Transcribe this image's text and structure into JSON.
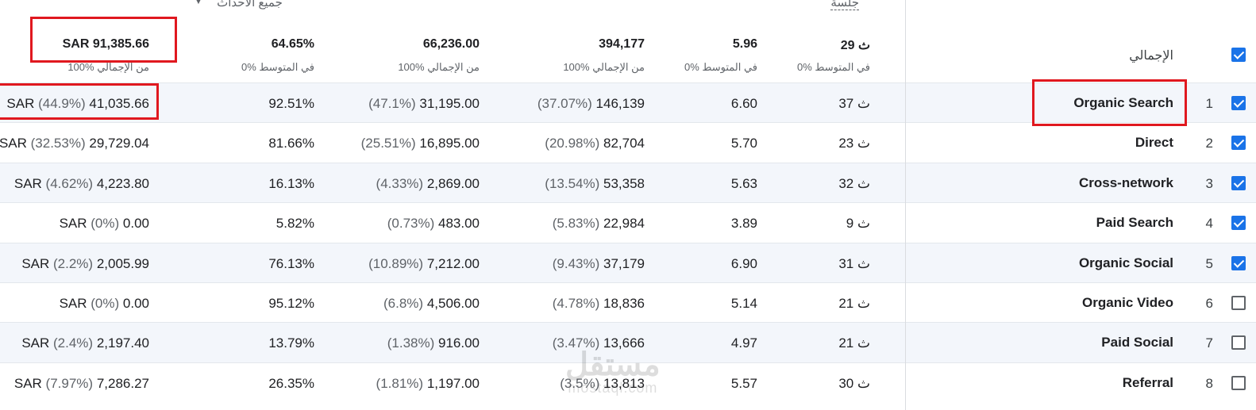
{
  "header": {
    "events_dropdown_label": "جميع الأحداث",
    "session_label": "جلسة",
    "total_label": "الإجمالي",
    "columns": [
      {
        "value": "SAR 91,385.66",
        "sub": "100% من الإجمالي"
      },
      {
        "value": "64.65%",
        "sub": "0% في المتوسط"
      },
      {
        "value": "66,236.00",
        "sub": "100% من الإجمالي"
      },
      {
        "value": "394,177",
        "sub": "100% من الإجمالي"
      },
      {
        "value": "5.96",
        "sub": "0% في المتوسط"
      },
      {
        "value": "29 ث",
        "sub": "0% في المتوسط"
      }
    ]
  },
  "rows": [
    {
      "index": "1",
      "name": "Organic Search",
      "checked": true,
      "revenue_prefix": "SAR ",
      "revenue_pct": "(44.9%)",
      "revenue": "41,035.66",
      "rate": "92.51%",
      "conv_pct": "(47.1%)",
      "conv": "31,195.00",
      "events_pct": "(37.07%)",
      "events": "146,139",
      "per_session": "6.60",
      "duration": "37 ث"
    },
    {
      "index": "2",
      "name": "Direct",
      "checked": true,
      "revenue_prefix": "SAR ",
      "revenue_pct": "(32.53%)",
      "revenue": "29,729.04",
      "rate": "81.66%",
      "conv_pct": "(25.51%)",
      "conv": "16,895.00",
      "events_pct": "(20.98%)",
      "events": "82,704",
      "per_session": "5.70",
      "duration": "23 ث"
    },
    {
      "index": "3",
      "name": "Cross-network",
      "checked": true,
      "revenue_prefix": "SAR ",
      "revenue_pct": "(4.62%)",
      "revenue": "4,223.80",
      "rate": "16.13%",
      "conv_pct": "(4.33%)",
      "conv": "2,869.00",
      "events_pct": "(13.54%)",
      "events": "53,358",
      "per_session": "5.63",
      "duration": "32 ث"
    },
    {
      "index": "4",
      "name": "Paid Search",
      "checked": true,
      "revenue_prefix": "SAR ",
      "revenue_pct": "(0%)",
      "revenue": "0.00",
      "rate": "5.82%",
      "conv_pct": "(0.73%)",
      "conv": "483.00",
      "events_pct": "(5.83%)",
      "events": "22,984",
      "per_session": "3.89",
      "duration": "9 ث"
    },
    {
      "index": "5",
      "name": "Organic Social",
      "checked": true,
      "revenue_prefix": "SAR ",
      "revenue_pct": "(2.2%)",
      "revenue": "2,005.99",
      "rate": "76.13%",
      "conv_pct": "(10.89%)",
      "conv": "7,212.00",
      "events_pct": "(9.43%)",
      "events": "37,179",
      "per_session": "6.90",
      "duration": "31 ث"
    },
    {
      "index": "6",
      "name": "Organic Video",
      "checked": false,
      "revenue_prefix": "SAR ",
      "revenue_pct": "(0%)",
      "revenue": "0.00",
      "rate": "95.12%",
      "conv_pct": "(6.8%)",
      "conv": "4,506.00",
      "events_pct": "(4.78%)",
      "events": "18,836",
      "per_session": "5.14",
      "duration": "21 ث"
    },
    {
      "index": "7",
      "name": "Paid Social",
      "checked": false,
      "revenue_prefix": "SAR ",
      "revenue_pct": "(2.4%)",
      "revenue": "2,197.40",
      "rate": "13.79%",
      "conv_pct": "(1.38%)",
      "conv": "916.00",
      "events_pct": "(3.47%)",
      "events": "13,666",
      "per_session": "4.97",
      "duration": "21 ث"
    },
    {
      "index": "8",
      "name": "Referral",
      "checked": false,
      "revenue_prefix": "SAR ",
      "revenue_pct": "(7.97%)",
      "revenue": "7,286.27",
      "rate": "26.35%",
      "conv_pct": "(1.81%)",
      "conv": "1,197.00",
      "events_pct": "(3.5%)",
      "events": "13,813",
      "per_session": "5.57",
      "duration": "30 ث"
    }
  ],
  "watermark": {
    "text": "مستقل",
    "sub": "mostaql.com"
  },
  "colors": {
    "highlight_box": "#e0181f",
    "checkbox_on": "#1a73e8",
    "row_alt": "#f3f6fb"
  }
}
